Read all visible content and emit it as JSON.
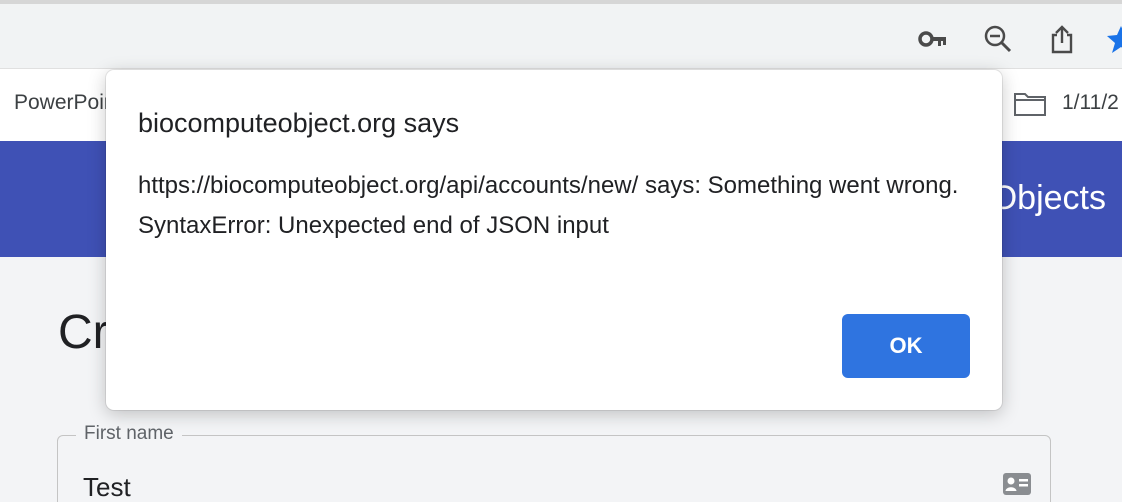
{
  "browser": {
    "bookmarks": {
      "item_label": "PowerPoint",
      "folder_icon": "folder-icon",
      "date_label": "1/11/2"
    },
    "toolbar_icons": [
      "key-icon",
      "zoom-out-icon",
      "share-icon",
      "star-icon"
    ]
  },
  "app": {
    "header_title": "BioCompute Objects",
    "page_heading": "Create",
    "first_name": {
      "label": "First name",
      "value": "Test",
      "icon": "contact-card-icon"
    }
  },
  "dialog": {
    "title": "biocomputeobject.org says",
    "message": "https://biocomputeobject.org/api/accounts/new/ says: Something went wrong. SyntaxError: Unexpected end of JSON input",
    "ok_label": "OK"
  },
  "colors": {
    "header_bg": "#3f51b5",
    "ok_button_bg": "#2f74e0",
    "star_icon": "#1a73e8"
  }
}
